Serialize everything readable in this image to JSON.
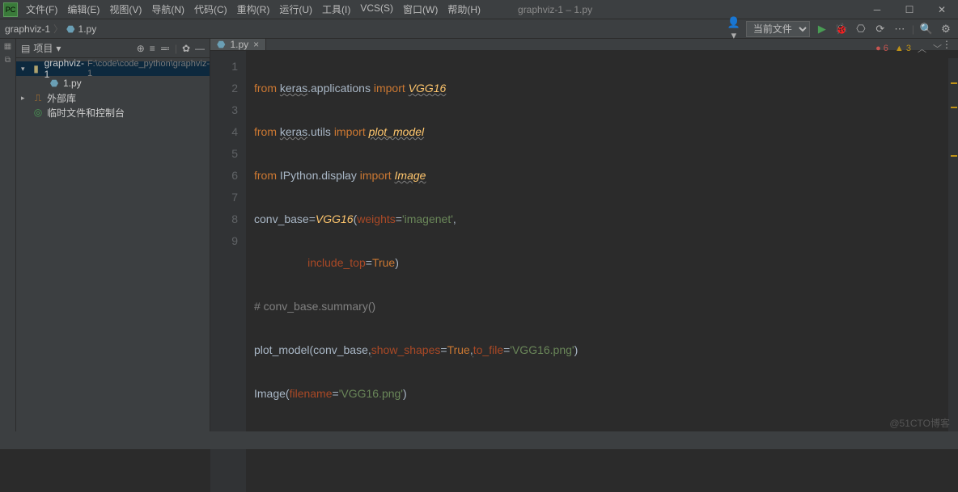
{
  "window": {
    "title": "graphviz-1 – 1.py"
  },
  "menu": [
    "文件(F)",
    "编辑(E)",
    "视图(V)",
    "导航(N)",
    "代码(C)",
    "重构(R)",
    "运行(U)",
    "工具(I)",
    "VCS(S)",
    "窗口(W)",
    "帮助(H)"
  ],
  "breadcrumbs": {
    "project": "graphviz-1",
    "file": "1.py"
  },
  "run_config": "当前文件",
  "sidebar": {
    "title": "项目",
    "root": {
      "name": "graphviz-1",
      "path": "F:\\code\\code_python\\graphviz-1"
    },
    "file": "1.py",
    "external": "外部库",
    "scratch": "临时文件和控制台"
  },
  "tab": {
    "label": "1.py"
  },
  "inspection": {
    "errors": "6",
    "warnings": "3"
  },
  "gutter": [
    "1",
    "2",
    "3",
    "4",
    "5",
    "6",
    "7",
    "8",
    "9"
  ],
  "code": {
    "l1": {
      "a": "from ",
      "b": "keras",
      "c": ".applications ",
      "d": "import ",
      "e": "VGG16"
    },
    "l2": {
      "a": "from ",
      "b": "keras",
      "c": ".utils ",
      "d": "import ",
      "e": "plot_model"
    },
    "l3": {
      "a": "from ",
      "b": "IPython",
      "c": ".display ",
      "d": "import ",
      "e": "Image"
    },
    "l4": {
      "a": "conv_base=",
      "b": "VGG16",
      "c": "(",
      "d": "weights",
      "e": "=",
      "f": "'imagenet'",
      "g": ","
    },
    "l5": {
      "a": "                 ",
      "b": "include_top",
      "c": "=",
      "d": "True",
      "e": ")"
    },
    "l6": {
      "a": "# conv_base.summary()"
    },
    "l7": {
      "a": "plot_model(conv_base",
      "b": ",",
      "c": "show_shapes",
      "d": "=",
      "e": "True",
      "f": ",",
      "g": "to_file",
      "h": "=",
      "i": "'VGG16.png'",
      "j": ")"
    },
    "l8": {
      "a": "Image(",
      "b": "filename",
      "c": "=",
      "d": "'VGG16.png'",
      "e": ")"
    }
  },
  "watermark": "@51CTO博客"
}
